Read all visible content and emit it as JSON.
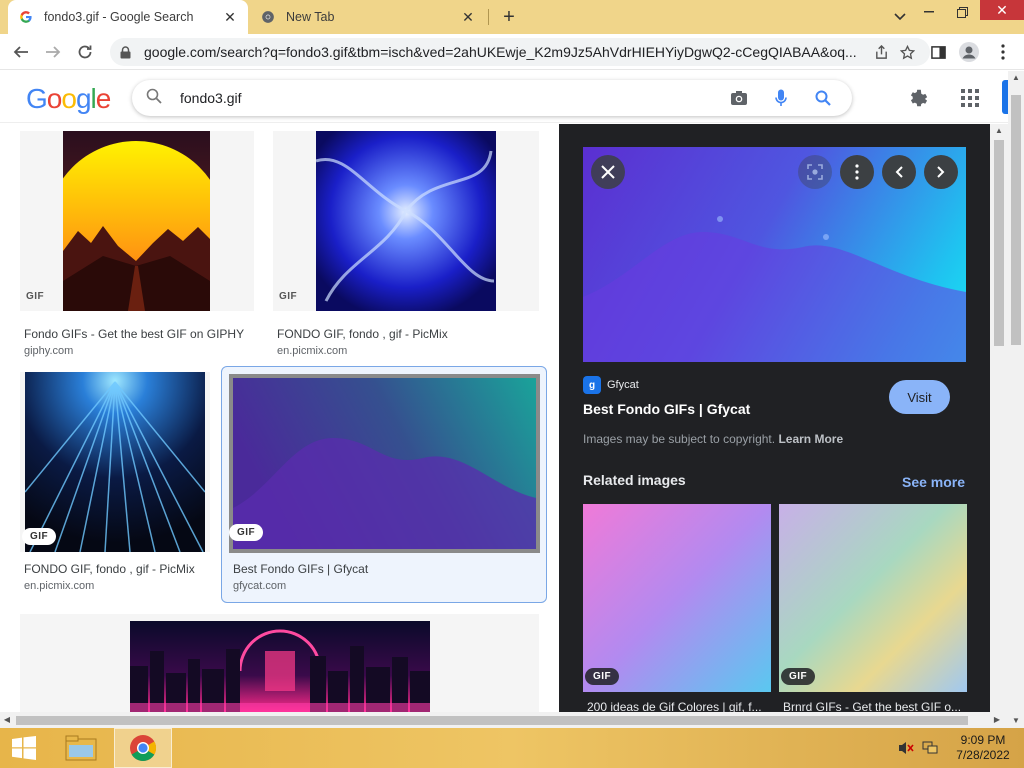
{
  "browser": {
    "tabs": [
      {
        "title": "fondo3.gif - Google Search",
        "active": true
      },
      {
        "title": "New Tab",
        "active": false
      }
    ],
    "url": "google.com/search?q=fondo3.gif&tbm=isch&ved=2ahUKEwje_K2m9Jz5AhVdrHIEHYiyDgwQ2-cCegQIABAA&oq..."
  },
  "google": {
    "logo": "Google",
    "query": "fondo3.gif"
  },
  "results": [
    {
      "title": "Fondo GIFs - Get the best GIF on GIPHY",
      "source": "giphy.com",
      "badge": "GIF"
    },
    {
      "title": "FONDO GIF, fondo , gif - PicMix",
      "source": "en.picmix.com",
      "badge": "GIF"
    },
    {
      "title": "FONDO GIF, fondo , gif - PicMix",
      "source": "en.picmix.com",
      "badge": "GIF"
    },
    {
      "title": "Best Fondo GIFs | Gfycat",
      "source": "gfycat.com",
      "badge": "GIF"
    }
  ],
  "preview": {
    "source_name": "Gfycat",
    "source_favicon": "g",
    "title": "Best Fondo GIFs | Gfycat",
    "visit_label": "Visit",
    "copyright_text": "Images may be subject to copyright.",
    "learn_more": "Learn More",
    "related_heading": "Related images",
    "see_more": "See more",
    "related": [
      {
        "caption": "200 ideas de Gif Colores | gif, f...",
        "badge": "GIF"
      },
      {
        "caption": "Brnrd GIFs - Get the best GIF o...",
        "badge": "GIF"
      }
    ]
  },
  "taskbar": {
    "time": "9:09 PM",
    "date": "7/28/2022"
  },
  "colors": {
    "accent": "#1a73e8",
    "panel_bg": "#202124",
    "tab_strip": "#f0d58a",
    "close_red": "#c7363a"
  }
}
